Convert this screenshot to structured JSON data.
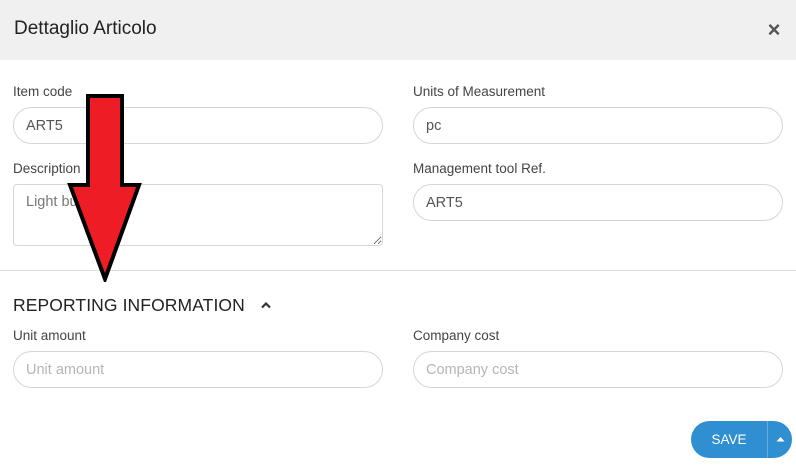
{
  "header": {
    "title": "Dettaglio Articolo",
    "close_symbol": "×"
  },
  "fields": {
    "item_code": {
      "label": "Item code",
      "value": "ART5"
    },
    "units": {
      "label": "Units of Measurement",
      "value": "pc"
    },
    "description": {
      "label": "Description",
      "value": "Light bulb"
    },
    "management_ref": {
      "label": "Management tool Ref.",
      "value": "ART5"
    }
  },
  "reporting": {
    "title": "REPORTING INFORMATION",
    "unit_amount": {
      "label": "Unit amount",
      "placeholder": "Unit amount",
      "value": ""
    },
    "company_cost": {
      "label": "Company cost",
      "placeholder": "Company cost",
      "value": ""
    }
  },
  "footer": {
    "save_label": "SAVE"
  },
  "colors": {
    "accent": "#2f8fd0",
    "arrow_fill": "#ee1c24",
    "header_bg": "#f0f0f0"
  },
  "icons": [
    "close-icon",
    "chevron-up-icon",
    "caret-up-icon",
    "annotation-arrow"
  ]
}
